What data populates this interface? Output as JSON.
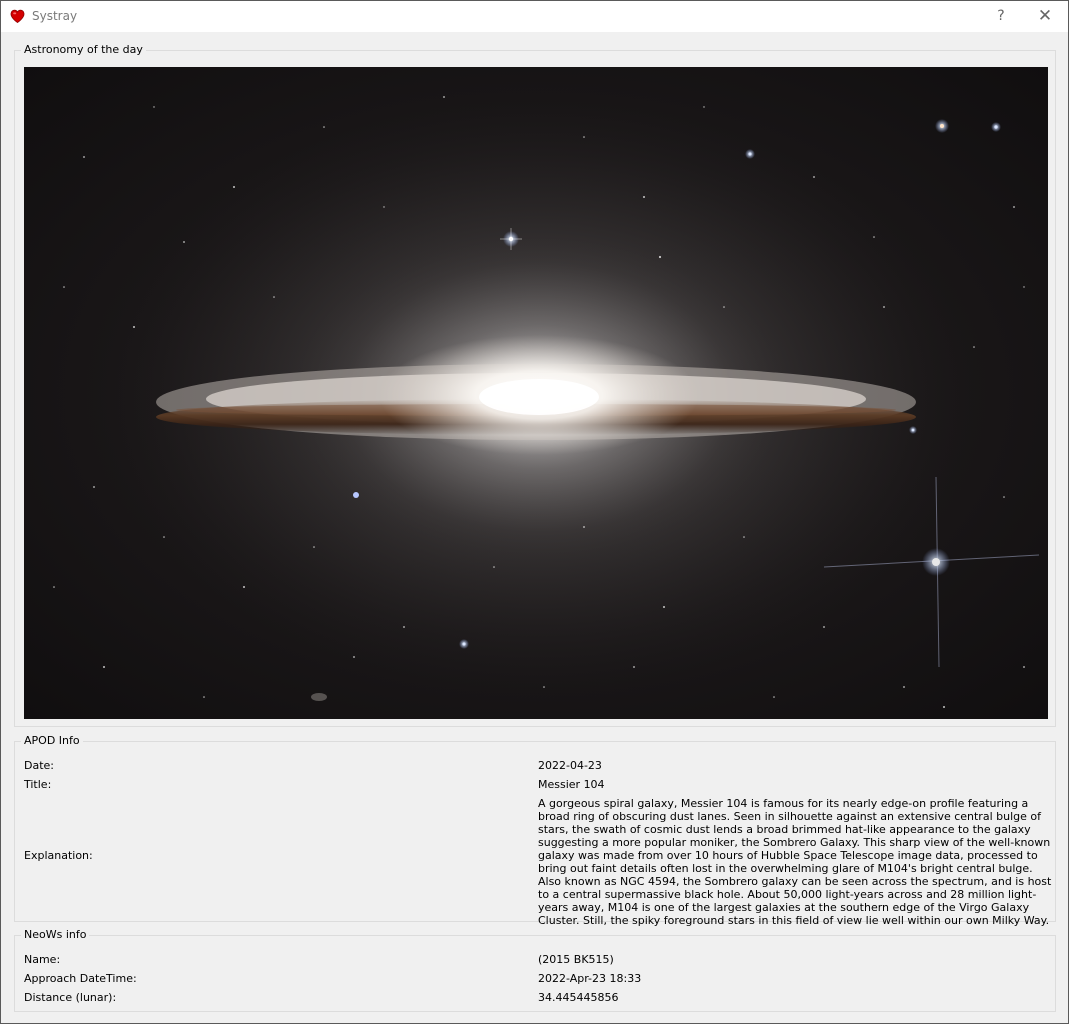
{
  "window": {
    "title": "Systray",
    "help_label": "?",
    "close_label": "✕",
    "icon": "heart-icon",
    "icon_color": "#d40000"
  },
  "apod_group": {
    "title": "Astronomy of the day",
    "image_subject": "sombrero-galaxy"
  },
  "apod_info": {
    "title": "APOD Info",
    "date_label": "Date:",
    "date_value": "2022-04-23",
    "title_label": "Title:",
    "title_value": "Messier 104",
    "explanation_label": "Explanation:",
    "explanation_value": "A gorgeous spiral galaxy, Messier 104 is famous for its nearly edge-on profile featuring a broad ring of obscuring dust lanes. Seen in silhouette against an extensive central bulge of stars, the swath of cosmic dust lends a broad brimmed hat-like appearance to the galaxy suggesting a more popular moniker, the Sombrero Galaxy. This sharp view of the well-known galaxy was made from over 10 hours of Hubble Space Telescope image data, processed to bring out faint details often lost in the overwhelming glare of M104's bright central bulge. Also known as NGC 4594, the Sombrero galaxy can be seen across the spectrum, and is host to a central supermassive black hole. About 50,000 light-years across and 28 million light-years away, M104 is one of the largest galaxies at the southern edge of the Virgo Galaxy Cluster. Still, the spiky foreground stars in this field of view lie well within our own Milky Way."
  },
  "neows_info": {
    "title": "NeoWs info",
    "name_label": "Name:",
    "name_value": "(2015 BK515)",
    "approach_label": "Approach DateTime:",
    "approach_value": "2022-Apr-23 18:33",
    "distance_label": "Distance (lunar):",
    "distance_value": "34.445445856"
  }
}
